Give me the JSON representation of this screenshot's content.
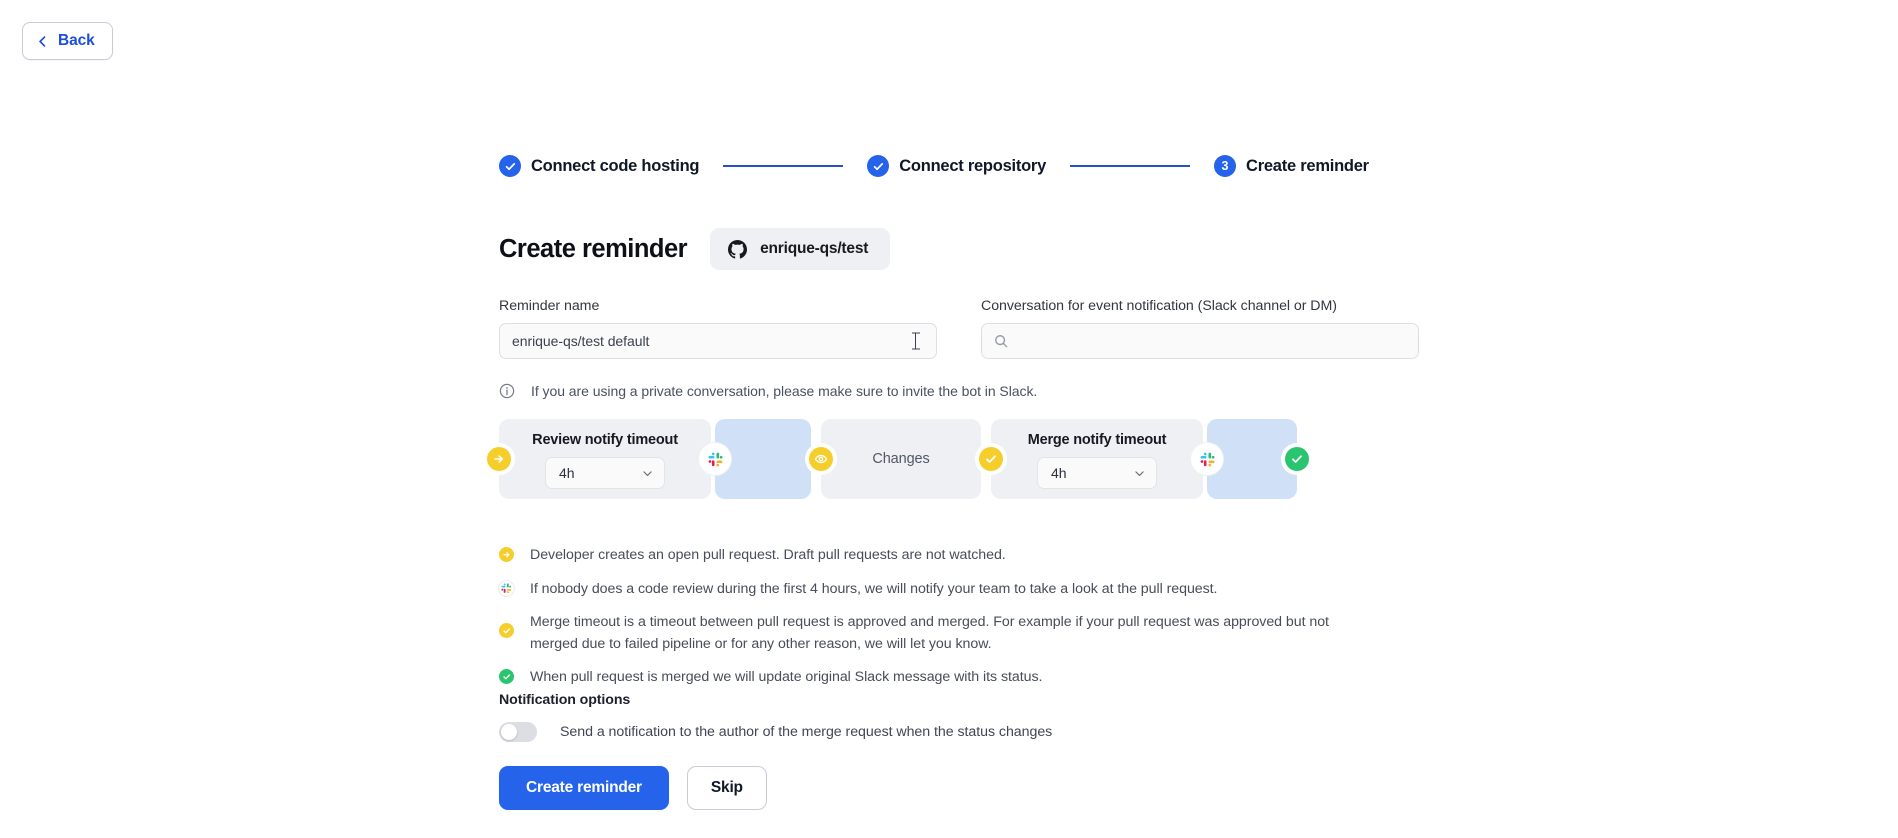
{
  "back": {
    "label": "Back",
    "icon": "chevron-left-icon"
  },
  "stepper": {
    "steps": [
      {
        "label": "Connect code hosting",
        "state": "complete",
        "marker": "check"
      },
      {
        "label": "Connect repository",
        "state": "complete",
        "marker": "check"
      },
      {
        "label": "Create reminder",
        "state": "active",
        "marker": "3"
      }
    ],
    "line_color": "#2a4fc4",
    "accent": "#2563eb"
  },
  "header": {
    "title": "Create reminder",
    "repo_badge": {
      "name": "enrique-qs/test",
      "icon": "github-icon"
    }
  },
  "form": {
    "reminder_name": {
      "label": "Reminder name",
      "value": "enrique-qs/test default",
      "placeholder": ""
    },
    "conversation": {
      "label": "Conversation for event notification (Slack channel or DM)",
      "value": "",
      "placeholder": "",
      "icon": "search-icon"
    }
  },
  "info_note": {
    "icon": "info-circle-icon",
    "text": "If you are using a private conversation, please make sure to invite the bot in Slack."
  },
  "timeline": {
    "segments": [
      {
        "kind": "gray",
        "title": "Review notify timeout",
        "select_value": "4h"
      },
      {
        "kind": "blue",
        "title": "",
        "select_value": ""
      },
      {
        "kind": "gray",
        "title": "",
        "center_label": "Changes"
      },
      {
        "kind": "gray",
        "title": "Merge notify timeout",
        "select_value": "4h"
      },
      {
        "kind": "blue",
        "title": "",
        "select_value": ""
      }
    ],
    "nodes": [
      {
        "icon": "arrow-right-icon",
        "color": "#f5ce2c",
        "style": "yellow"
      },
      {
        "icon": "slack-icon",
        "color": "#ffffff",
        "style": "slack"
      },
      {
        "icon": "eye-icon",
        "color": "#f5ce2c",
        "style": "yellow"
      },
      {
        "icon": "check-icon",
        "color": "#f5ce2c",
        "style": "yellow"
      },
      {
        "icon": "slack-icon",
        "color": "#ffffff",
        "style": "slack"
      },
      {
        "icon": "check-icon",
        "color": "#2cc56f",
        "style": "green"
      }
    ]
  },
  "legend": [
    {
      "icon": "arrow-right-icon",
      "style": "yellow",
      "text": "Developer creates an open pull request. Draft pull requests are not watched."
    },
    {
      "icon": "slack-icon",
      "style": "slackbg",
      "text": "If nobody does a code review during the first 4 hours, we will notify your team to take a look at the pull request."
    },
    {
      "icon": "check-icon",
      "style": "yellow",
      "text": "Merge timeout is a timeout between pull request is approved and merged. For example if your pull request was approved but not merged due to failed pipeline or for any other reason, we will let you know."
    },
    {
      "icon": "check-icon",
      "style": "green",
      "text": "When pull request is merged we will update original Slack message with its status."
    }
  ],
  "notification_options": {
    "title": "Notification options",
    "toggle": {
      "label": "Send a notification to the author of the merge request when the status changes",
      "state": "off"
    }
  },
  "actions": {
    "primary_label": "Create reminder",
    "secondary_label": "Skip"
  },
  "colors": {
    "accent_blue": "#2563eb",
    "yellow": "#f5ce2c",
    "green": "#2cc56f",
    "segment_gray": "#eff0f3",
    "segment_blue": "#cfe0f7"
  }
}
